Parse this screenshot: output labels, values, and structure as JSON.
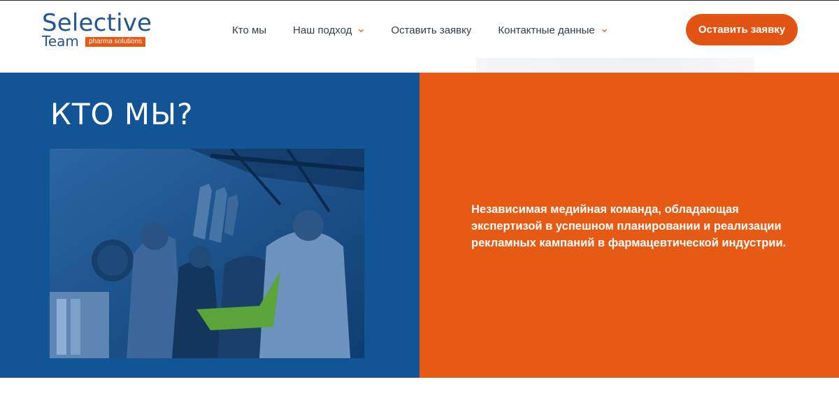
{
  "brand": {
    "name": "Selective",
    "name_line2": "Team",
    "tagline": "pharma solutions",
    "color_primary": "#1f5596",
    "color_accent": "#e75a14"
  },
  "nav": {
    "items": [
      {
        "label": "Кто мы",
        "has_dropdown": false
      },
      {
        "label": "Наш подход",
        "has_dropdown": true
      },
      {
        "label": "Оставить заявку",
        "has_dropdown": false
      },
      {
        "label": "Контактные данные",
        "has_dropdown": true
      }
    ],
    "cta_label": "Оставить заявку"
  },
  "about": {
    "title": "КТО МЫ?",
    "description": "Независимая медийная команда, обладающая экспертизой в успешном планировании и реализации рекламных кампаний в фармацевтической индустрии.",
    "photo_icon": "team-high-five-photo",
    "left_bg": "#125596",
    "right_bg": "#e75a14"
  }
}
